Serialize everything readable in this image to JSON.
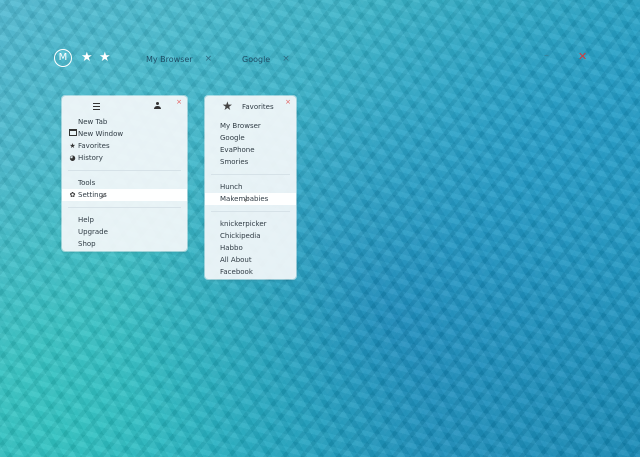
{
  "topbar": {
    "logo_letter": "M",
    "tabs": [
      {
        "label": "My Browser"
      },
      {
        "label": "Google"
      }
    ],
    "close_glyph": "×"
  },
  "main_menu": {
    "close_glyph": "×",
    "group1": [
      {
        "label": "New Tab",
        "icon": ""
      },
      {
        "label": "New Window",
        "icon": "window-icon"
      },
      {
        "label": "Favorites",
        "icon": "star-icon"
      },
      {
        "label": "History",
        "icon": "clock-icon"
      }
    ],
    "group2": [
      {
        "label": "Tools",
        "icon": ""
      },
      {
        "label": "Settings",
        "icon": "gear-icon"
      }
    ],
    "group3": [
      {
        "label": "Help"
      },
      {
        "label": "Upgrade"
      },
      {
        "label": "Shop"
      }
    ]
  },
  "favorites_menu": {
    "title": "Favorites",
    "close_glyph": "×",
    "group1": [
      "My Browser",
      "Google",
      "EvaPhone",
      "Smories"
    ],
    "group2": [
      "Hunch",
      "Makembabies"
    ],
    "group3": [
      "knickerpicker",
      "Chickipedia",
      "Habbo",
      "All About",
      "Facebook"
    ]
  },
  "colors": {
    "accent_close": "#d23b3b",
    "menu_bg": "#f4f8fa",
    "text": "#2f3b44"
  }
}
